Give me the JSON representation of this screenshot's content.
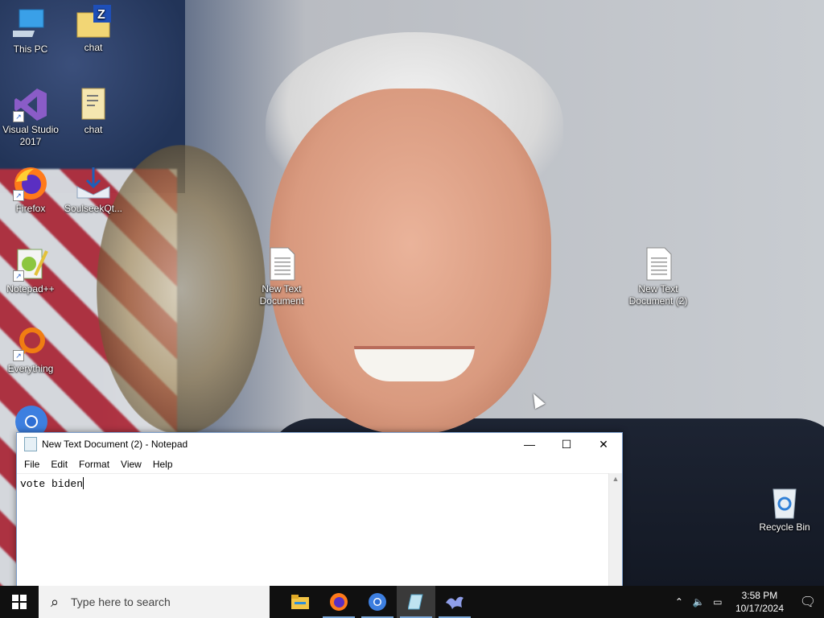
{
  "desktop": {
    "icons": [
      {
        "label": "This PC",
        "icon": "this-pc-icon"
      },
      {
        "label": "chat",
        "icon": "zip-folder-icon"
      },
      {
        "label": "Visual Studio 2017",
        "icon": "visual-studio-icon"
      },
      {
        "label": "chat",
        "icon": "document-icon"
      },
      {
        "label": "Firefox",
        "icon": "firefox-icon"
      },
      {
        "label": "SoulseekQt...",
        "icon": "soulseek-icon"
      },
      {
        "label": "Notepad++",
        "icon": "notepadpp-icon"
      },
      {
        "label": "Everything",
        "icon": "everything-icon"
      },
      {
        "label": "New Text Document",
        "icon": "text-file-icon"
      },
      {
        "label": "New Text Document (2)",
        "icon": "text-file-icon"
      },
      {
        "label": "Recycle Bin",
        "icon": "recycle-bin-icon"
      }
    ]
  },
  "notepad": {
    "title": "New Text Document (2) - Notepad",
    "menu": [
      "File",
      "Edit",
      "Format",
      "View",
      "Help"
    ],
    "content": "vote biden",
    "controls": {
      "minimize": "—",
      "maximize": "☐",
      "close": "✕"
    }
  },
  "taskbar": {
    "search_placeholder": "Type here to search",
    "apps": [
      "file-explorer-icon",
      "firefox-icon",
      "chrome-icon",
      "notepad-icon",
      "soulseek-icon"
    ],
    "clock_time": "3:58 PM",
    "clock_date": "10/17/2024"
  },
  "colors": {
    "taskbar_bg": "#101010",
    "accent": "#7aa7d8"
  }
}
